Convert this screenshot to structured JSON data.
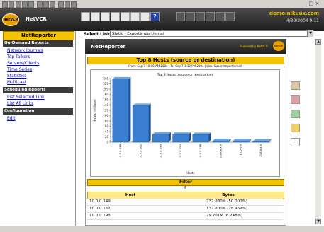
{
  "browser": {
    "window_controls": "_ □ ×"
  },
  "header": {
    "logo_text": "NetVCR",
    "domain": "demo.nikuux.com",
    "datetime": "4/30/2004 9:11"
  },
  "sidebar": {
    "title": "NetReporter",
    "sections": [
      {
        "title": "On-Demand Reports",
        "items": [
          "Network Journals",
          "Top Talkers",
          "Servers/Clients",
          "Time Series",
          "Statistics",
          "Multicast"
        ]
      },
      {
        "title": "Scheduled Reports",
        "items": [
          "List Selected Link",
          "List All Links"
        ]
      },
      {
        "title": "Configuration",
        "items": [
          "Edit"
        ]
      }
    ]
  },
  "select_link": {
    "label": "Select Link :",
    "value": "Static - ExportImport/email"
  },
  "panel": {
    "title": "NetReporter",
    "powered_by": "Powered by NetVCR"
  },
  "report": {
    "title": "Top 8 Hosts (source or destination)",
    "subtitle": "From: Sep 7 10:00 AM 2004 | To: Sep 7 1:12 PM 2004 | Link: ExportImport/email"
  },
  "chart_data": {
    "type": "bar",
    "title": "Top 8 Hosts (source or destination)",
    "xlabel": "Hosts",
    "ylabel": "Bytes (millions)",
    "ylim": [
      0,
      240
    ],
    "yticks": [
      0,
      20,
      40,
      60,
      80,
      100,
      120,
      140,
      160,
      180,
      200,
      220,
      240
    ],
    "categories": [
      "10.0.0.249",
      "10.0.0.162",
      "10.0.0.193",
      "10.0.0.153",
      "10.0.0.138",
      "209.68.x.x",
      "10.0.0.x",
      "216.x.x.x"
    ],
    "values": [
      237.8,
      137.8,
      29.7,
      29.0,
      28.5,
      5.0,
      4.0,
      3.0
    ],
    "color": "#3a7fd0"
  },
  "filter": {
    "title": "Filter",
    "value": "IP"
  },
  "table": {
    "headers": [
      "Host",
      "Bytes"
    ],
    "rows": [
      {
        "host": "10.0.0.249",
        "bytes": "237.880M (50.000%)"
      },
      {
        "host": "10.0.0.162",
        "bytes": "137.800M (28.969%)"
      },
      {
        "host": "10.0.0.193",
        "bytes": "29.701M (6.248%)"
      }
    ]
  }
}
